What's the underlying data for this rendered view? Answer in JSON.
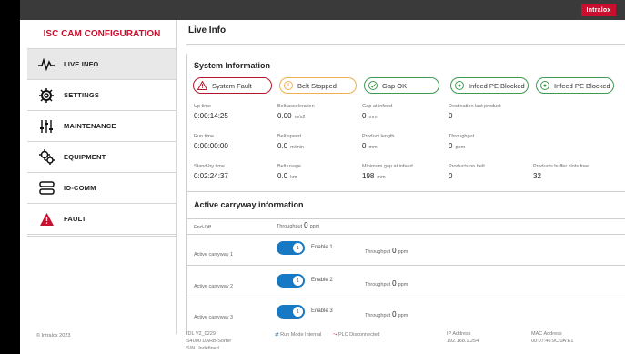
{
  "brand": "Intralox",
  "sidebar": {
    "title": "ISC CAM CONFIGURATION",
    "items": [
      {
        "label": "LIVE INFO",
        "icon": "pulse-icon"
      },
      {
        "label": "SETTINGS",
        "icon": "gear-icon"
      },
      {
        "label": "MAINTENANCE",
        "icon": "sliders-icon"
      },
      {
        "label": "EQUIPMENT",
        "icon": "gears-icon"
      },
      {
        "label": "IO-COMM",
        "icon": "server-icon"
      },
      {
        "label": "FAULT",
        "icon": "warning-icon"
      }
    ]
  },
  "main": {
    "title": "Live Info",
    "system_info_title": "System Information",
    "badges": [
      "System Fault",
      "Belt Stopped",
      "Gap OK",
      "Infeed PE Blocked",
      "Infeed PE Blocked"
    ],
    "metrics": [
      {
        "label": "Up time",
        "value": "0:00:14:25",
        "unit": ""
      },
      {
        "label": "Belt acceleration",
        "value": "0.00",
        "unit": "m/s2"
      },
      {
        "label": "Gap at infeed",
        "value": "0",
        "unit": "mm"
      },
      {
        "label": "Destination last product",
        "value": "0",
        "unit": ""
      },
      {
        "label": "Run time",
        "value": "0:00:00:00",
        "unit": ""
      },
      {
        "label": "Belt speed",
        "value": "0.0",
        "unit": "m/min"
      },
      {
        "label": "Product length",
        "value": "0",
        "unit": "mm"
      },
      {
        "label": "Throughput",
        "value": "0",
        "unit": "ppm"
      },
      {
        "label": "Stand-by time",
        "value": "0:02:24:37",
        "unit": ""
      },
      {
        "label": "Belt usage",
        "value": "0.0",
        "unit": "km"
      },
      {
        "label": "Minimum gap at infeed",
        "value": "198",
        "unit": "mm"
      },
      {
        "label": "Products on belt",
        "value": "0",
        "unit": ""
      },
      {
        "label": "Products buffer slots free",
        "value": "32",
        "unit": ""
      }
    ],
    "carryway_title": "Active carryway information",
    "rows": [
      {
        "label": "End-Off",
        "throughput_label": "Throughput",
        "throughput": "0",
        "unit": "ppm"
      },
      {
        "label": "Active carryway 1",
        "toggle": "Enable 1",
        "knob": "1",
        "throughput_label": "Throughput",
        "throughput": "0",
        "unit": "ppm"
      },
      {
        "label": "Active carryway 2",
        "toggle": "Enable 2",
        "knob": "1",
        "throughput_label": "Throughput",
        "throughput": "0",
        "unit": "ppm"
      },
      {
        "label": "Active carryway 3",
        "toggle": "Enable 3",
        "knob": "1",
        "throughput_label": "Throughput",
        "throughput": "0",
        "unit": "ppm"
      }
    ]
  },
  "footer": {
    "copyright": "© Intralox 2023",
    "idl": "IDL V2_0229",
    "sorter": "S4000 DARB Sorter",
    "sn": "S/N Undefined",
    "mode": "Run Mode Internal",
    "plc": "PLC Disconnected",
    "ip_label": "IP Address",
    "ip": "192.168.1.254",
    "mac_label": "MAC Address",
    "mac": "00:07:46:9C:0A:E1"
  }
}
